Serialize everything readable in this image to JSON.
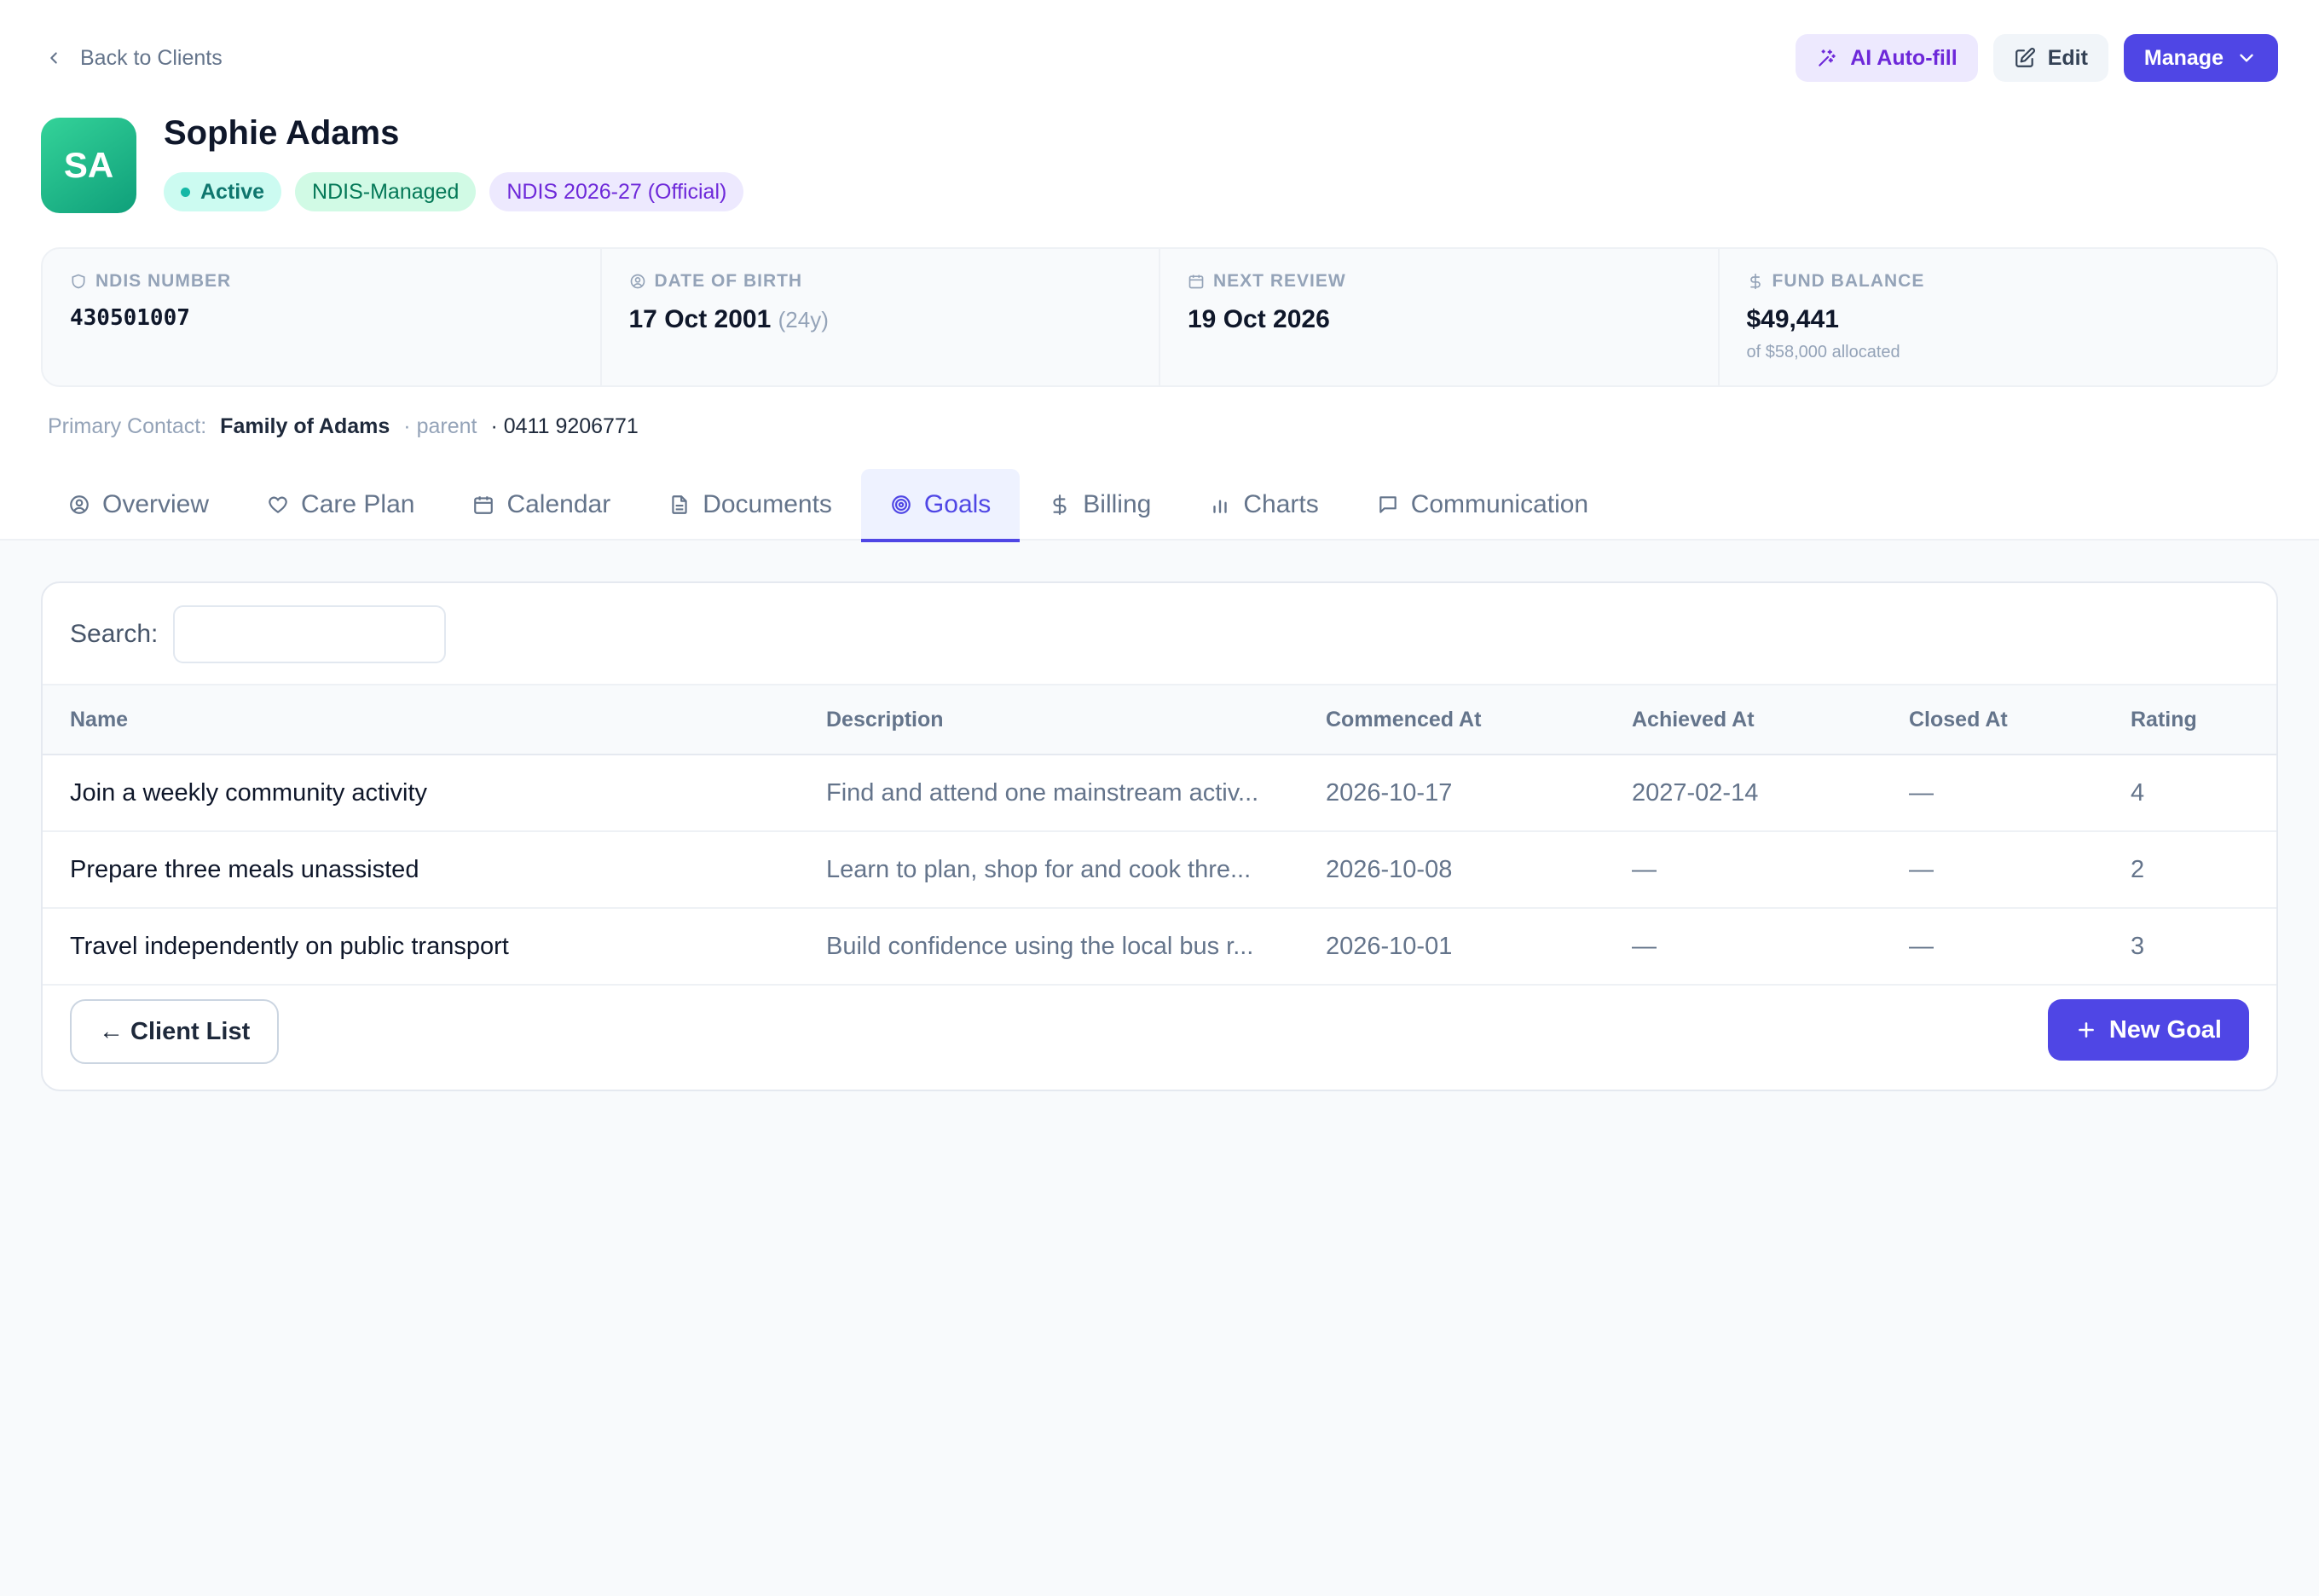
{
  "header": {
    "back_label": "Back to Clients",
    "ai_autofill_label": "AI Auto-fill",
    "edit_label": "Edit",
    "manage_label": "Manage"
  },
  "client": {
    "initials": "SA",
    "name": "Sophie Adams",
    "status": "Active",
    "management": "NDIS-Managed",
    "plan": "NDIS 2026-27 (Official)",
    "colors": {
      "avatar": "#10b981",
      "accent": "#4f46e5"
    }
  },
  "stats": {
    "ndis": {
      "label": "NDIS NUMBER",
      "value": "430501007",
      "icon": "shield-icon"
    },
    "dob": {
      "label": "DATE OF BIRTH",
      "value": "17 Oct 2001",
      "age": "(24y)",
      "icon": "user-circle-icon"
    },
    "review": {
      "label": "NEXT REVIEW",
      "value": "19 Oct 2026",
      "icon": "calendar-icon"
    },
    "fund": {
      "label": "FUND BALANCE",
      "value": "$49,441",
      "sub": "of $58,000 allocated",
      "icon": "dollar-icon"
    }
  },
  "contact": {
    "label": "Primary Contact:",
    "name": "Family of Adams",
    "relation": "· parent",
    "phone": "· 0411 9206771"
  },
  "tabs": [
    {
      "label": "Overview",
      "icon": "user-circle-icon"
    },
    {
      "label": "Care Plan",
      "icon": "heart-icon"
    },
    {
      "label": "Calendar",
      "icon": "calendar-icon"
    },
    {
      "label": "Documents",
      "icon": "document-icon"
    },
    {
      "label": "Goals",
      "icon": "target-icon",
      "active": true
    },
    {
      "label": "Billing",
      "icon": "dollar-icon"
    },
    {
      "label": "Charts",
      "icon": "bar-chart-icon"
    },
    {
      "label": "Communication",
      "icon": "message-icon"
    }
  ],
  "goals": {
    "search_label": "Search:",
    "search_value": "",
    "columns": {
      "name": "Name",
      "description": "Description",
      "commenced": "Commenced At",
      "achieved": "Achieved At",
      "closed": "Closed At",
      "rating": "Rating"
    },
    "rows": [
      {
        "name": "Join a weekly community activity",
        "description": "Find and attend one mainstream activ...",
        "commenced": "2026-10-17",
        "achieved": "2027-02-14",
        "closed": "—",
        "rating": "4"
      },
      {
        "name": "Prepare three meals unassisted",
        "description": "Learn to plan, shop for and cook thre...",
        "commenced": "2026-10-08",
        "achieved": "—",
        "closed": "—",
        "rating": "2"
      },
      {
        "name": "Travel independently on public transport",
        "description": "Build confidence using the local bus r...",
        "commenced": "2026-10-01",
        "achieved": "—",
        "closed": "—",
        "rating": "3"
      }
    ],
    "client_list_label": "← Client List",
    "new_goal_label": "New Goal"
  }
}
